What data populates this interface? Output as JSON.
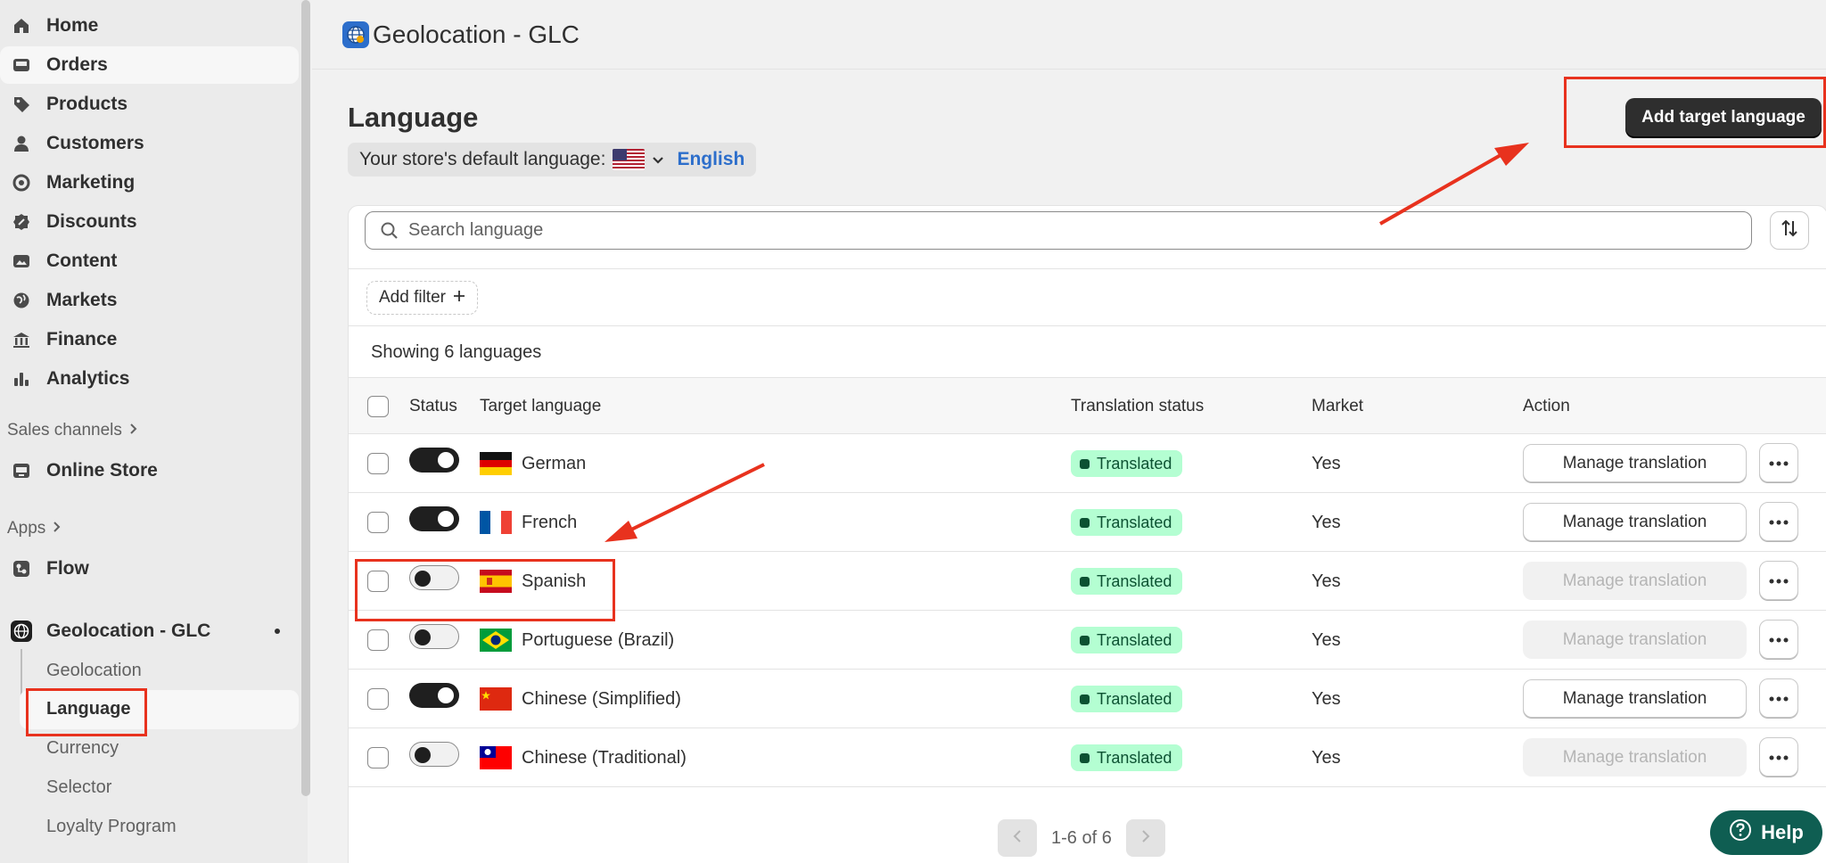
{
  "sidebar": {
    "nav_items": [
      {
        "label": "Home",
        "icon": "home-icon"
      },
      {
        "label": "Orders",
        "icon": "inbox-icon"
      },
      {
        "label": "Products",
        "icon": "tag-icon"
      },
      {
        "label": "Customers",
        "icon": "person-icon"
      },
      {
        "label": "Marketing",
        "icon": "target-icon"
      },
      {
        "label": "Discounts",
        "icon": "discount-icon"
      },
      {
        "label": "Content",
        "icon": "image-icon"
      },
      {
        "label": "Markets",
        "icon": "globe-icon"
      },
      {
        "label": "Finance",
        "icon": "bank-icon"
      },
      {
        "label": "Analytics",
        "icon": "bar-chart-icon"
      }
    ],
    "sales_channels_label": "Sales channels",
    "online_store_label": "Online Store",
    "apps_label": "Apps",
    "flow_label": "Flow",
    "app_label": "Geolocation - GLC",
    "app_sub_items": [
      "Geolocation",
      "Language",
      "Currency",
      "Selector",
      "Loyalty Program"
    ],
    "active_sub_item": "Language"
  },
  "header": {
    "title": "Geolocation - GLC"
  },
  "page": {
    "title": "Language",
    "default_language_prefix": "Your store's default language:",
    "default_language": "English",
    "add_button_label": "Add target language",
    "search_placeholder": "Search language",
    "add_filter_label": "Add filter",
    "showing_text": "Showing 6 languages",
    "columns": {
      "status": "Status",
      "target_language": "Target language",
      "translation_status": "Translation status",
      "market": "Market",
      "action": "Action"
    },
    "rows": [
      {
        "language": "German",
        "enabled": true,
        "translation_status": "Translated",
        "market": "Yes",
        "action": "Manage translation",
        "flag": "de"
      },
      {
        "language": "French",
        "enabled": true,
        "translation_status": "Translated",
        "market": "Yes",
        "action": "Manage translation",
        "flag": "fr"
      },
      {
        "language": "Spanish",
        "enabled": false,
        "translation_status": "Translated",
        "market": "Yes",
        "action": "Manage translation",
        "flag": "es"
      },
      {
        "language": "Portuguese (Brazil)",
        "enabled": false,
        "translation_status": "Translated",
        "market": "Yes",
        "action": "Manage translation",
        "flag": "br"
      },
      {
        "language": "Chinese (Simplified)",
        "enabled": true,
        "translation_status": "Translated",
        "market": "Yes",
        "action": "Manage translation",
        "flag": "cn"
      },
      {
        "language": "Chinese (Traditional)",
        "enabled": false,
        "translation_status": "Translated",
        "market": "Yes",
        "action": "Manage translation",
        "flag": "tw"
      }
    ],
    "pagination": "1-6 of 6",
    "help_label": "Help"
  },
  "colors": {
    "accent_link": "#2c6ecb",
    "badge_bg": "#b4fed2",
    "badge_text": "#0c5132",
    "annotation_red": "#e8321e",
    "help_bg": "#0f5e52"
  }
}
